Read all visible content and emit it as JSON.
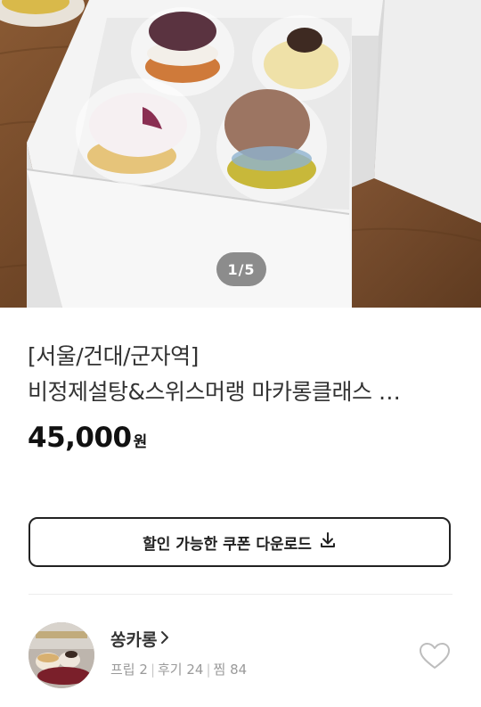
{
  "gallery": {
    "current": "1",
    "separator": "/",
    "total": "5"
  },
  "product": {
    "title_line1": "[서울/건대/군자역]",
    "title_line2": "비정제설탕&스위스머랭 마카롱클래스 …",
    "price_amount": "45,000",
    "price_unit": "원"
  },
  "coupon": {
    "label": "할인 가능한 쿠폰 다운로드",
    "icon": "download-icon"
  },
  "seller": {
    "name": "쏭카롱",
    "name_icon": "chevron-right-icon",
    "stats": [
      {
        "label": "프립",
        "value": "2"
      },
      {
        "label": "후기",
        "value": "24"
      },
      {
        "label": "찜",
        "value": "84"
      }
    ],
    "favorite_icon": "heart-outline-icon"
  }
}
